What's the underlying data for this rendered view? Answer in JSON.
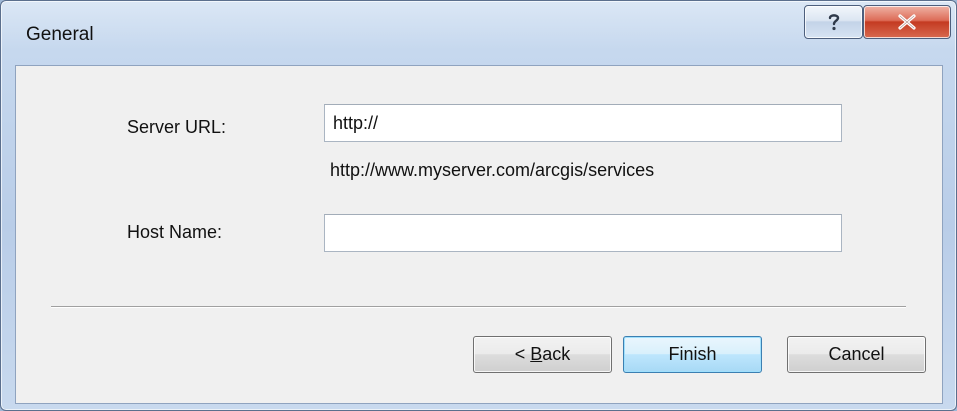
{
  "window": {
    "title": "General"
  },
  "titlebar": {
    "help_icon": "question-mark-icon",
    "close_icon": "close-x-icon",
    "help_glyph": "?",
    "close_glyph": "X"
  },
  "form": {
    "server_url": {
      "label": "Server URL:",
      "value": "http://",
      "hint": "http://www.myserver.com/arcgis/services"
    },
    "host_name": {
      "label": "Host Name:",
      "value": ""
    }
  },
  "buttons": {
    "back": {
      "prefix": "< ",
      "mnemonic": "B",
      "rest": "ack"
    },
    "finish": "Finish",
    "cancel": "Cancel"
  },
  "colors": {
    "accent": "#3c7fb1",
    "close_red": "#c43b22",
    "client_bg": "#f0f0f0"
  }
}
